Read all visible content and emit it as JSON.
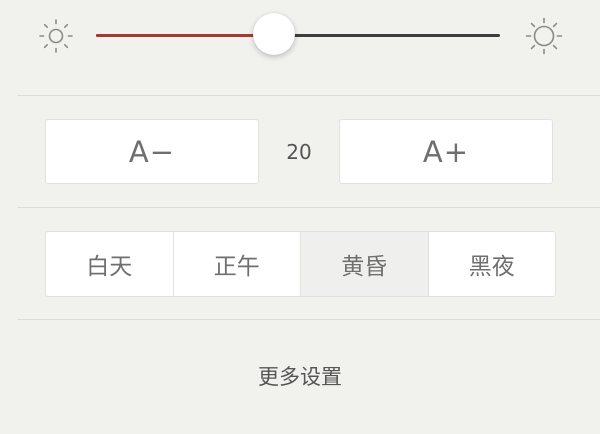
{
  "brightness": {
    "level_percent": 44,
    "low_icon": "sun-small-icon",
    "high_icon": "sun-large-icon",
    "fill_color": "#a33a33",
    "track_color": "#3d3d3d"
  },
  "font_size": {
    "decrease_label": "A−",
    "increase_label": "A+",
    "value": "20"
  },
  "themes": {
    "items": [
      {
        "label": "白天"
      },
      {
        "label": "正午"
      },
      {
        "label": "黄昏"
      },
      {
        "label": "黑夜"
      }
    ],
    "selected": "黄昏"
  },
  "more_settings": {
    "label": "更多设置"
  }
}
